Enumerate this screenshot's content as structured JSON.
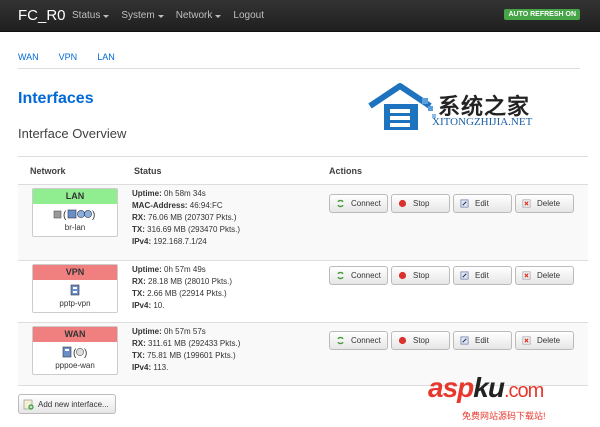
{
  "navbar": {
    "brand": "FC_R0",
    "menu": [
      {
        "label": "Status",
        "dropdown": true
      },
      {
        "label": "System",
        "dropdown": true
      },
      {
        "label": "Network",
        "dropdown": true
      },
      {
        "label": "Logout",
        "dropdown": false
      }
    ],
    "auto_refresh": "AUTO REFRESH ON",
    "auto_refresh_color": "#46a546"
  },
  "tabs": [
    "WAN",
    "VPN",
    "LAN"
  ],
  "page_title": "Interfaces",
  "section_title": "Interface Overview",
  "table": {
    "headers": {
      "network": "Network",
      "status": "Status",
      "actions": "Actions"
    },
    "rows": [
      {
        "name": "LAN",
        "header_color": "#90ee90",
        "device": "br-lan",
        "status": [
          {
            "label": "Uptime:",
            "value": " 0h 58m 34s"
          },
          {
            "label": "MAC-Address:",
            "value": " 46:94:FC"
          },
          {
            "label": "RX:",
            "value": " 76.06 MB (207307 Pkts.)"
          },
          {
            "label": "TX:",
            "value": " 316.69 MB (293470 Pkts.)"
          },
          {
            "label": "IPv4:",
            "value": " 192.168.7.1/24"
          }
        ]
      },
      {
        "name": "VPN",
        "header_color": "#f08080",
        "device": "pptp-vpn",
        "status": [
          {
            "label": "Uptime:",
            "value": " 0h 57m 49s"
          },
          {
            "label": "RX:",
            "value": " 28.18 MB (28010 Pkts.)"
          },
          {
            "label": "TX:",
            "value": " 2.66 MB (22914 Pkts.)"
          },
          {
            "label": "IPv4:",
            "value": " 10."
          }
        ]
      },
      {
        "name": "WAN",
        "header_color": "#f08080",
        "device": "pppoe-wan",
        "status": [
          {
            "label": "Uptime:",
            "value": " 0h 57m 57s"
          },
          {
            "label": "RX:",
            "value": " 311.61 MB (292433 Pkts.)"
          },
          {
            "label": "TX:",
            "value": " 75.81 MB (199601 Pkts.)"
          },
          {
            "label": "IPv4:",
            "value": " 113."
          }
        ]
      }
    ],
    "actions": {
      "connect": "Connect",
      "stop": "Stop",
      "edit": "Edit",
      "delete": "Delete"
    }
  },
  "add_interface": "Add new interface...",
  "watermark": {
    "site_chinese": "系统之家",
    "site_url": "XITONGZHIJIA.NET",
    "aspku_asp": "asp",
    "aspku_ku": "ku",
    "aspku_com": ".com",
    "aspku_sub": "免费网站源码下载站!"
  }
}
